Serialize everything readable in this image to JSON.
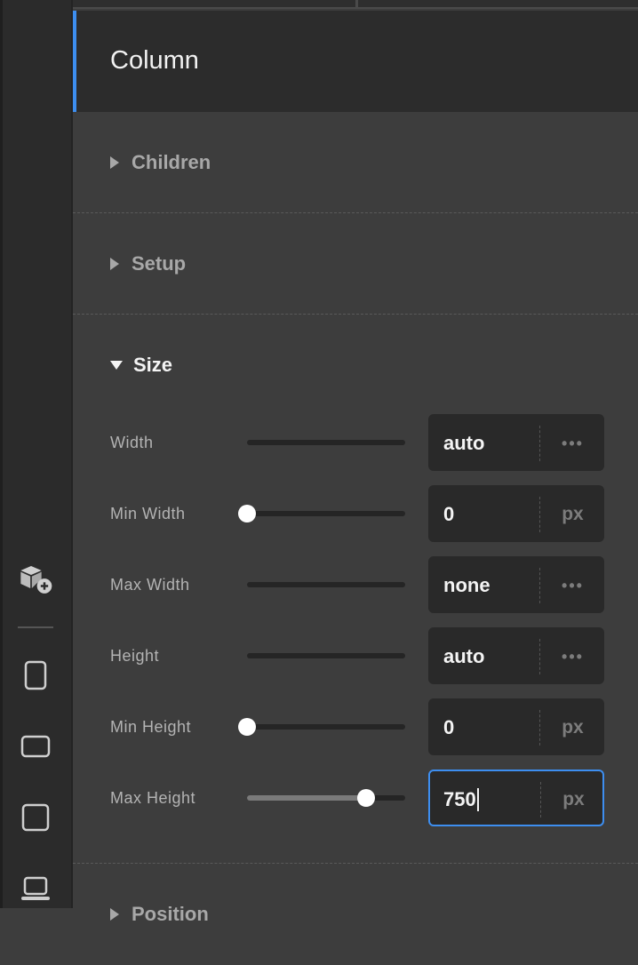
{
  "panel": {
    "title": "Column"
  },
  "sections": {
    "children": {
      "label": "Children"
    },
    "setup": {
      "label": "Setup"
    },
    "size": {
      "label": "Size"
    },
    "next": {
      "label": "Position"
    }
  },
  "size_props": [
    {
      "label": "Width",
      "value": "auto",
      "unit": "•••",
      "slider": null
    },
    {
      "label": "Min Width",
      "value": "0",
      "unit": "px",
      "slider": 0
    },
    {
      "label": "Max Width",
      "value": "none",
      "unit": "•••",
      "slider": null
    },
    {
      "label": "Height",
      "value": "auto",
      "unit": "•••",
      "slider": null
    },
    {
      "label": "Min Height",
      "value": "0",
      "unit": "px",
      "slider": 0
    },
    {
      "label": "Max Height",
      "value": "750",
      "unit": "px",
      "slider": 0.75
    }
  ],
  "icons": {
    "add_component": "cube-plus-icon",
    "device_1": "tablet-portrait-icon",
    "device_2": "tablet-landscape-icon",
    "device_3": "square-device-icon",
    "device_4": "laptop-icon"
  },
  "colors": {
    "accent": "#3d8ef0",
    "panel_bg": "#3d3d3d",
    "field_bg": "#292929",
    "rail_bg": "#2b2b2b"
  }
}
